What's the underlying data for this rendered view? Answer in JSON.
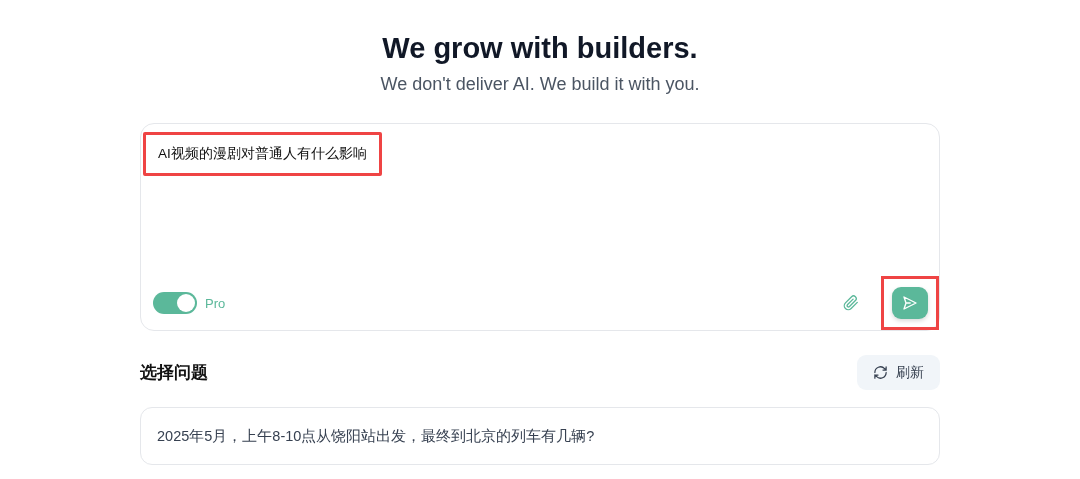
{
  "header": {
    "title": "We grow with builders.",
    "subtitle": "We don't deliver AI. We build it with you."
  },
  "composer": {
    "value": "AI视频的漫剧对普通人有什么影响",
    "value_highlighted": true,
    "pro_toggle": {
      "label": "Pro",
      "on": true
    },
    "send_highlighted": true
  },
  "questions": {
    "title": "选择问题",
    "refresh_label": "刷新",
    "items": [
      {
        "text": "2025年5月，上午8-10点从饶阳站出发，最终到北京的列车有几辆?"
      }
    ]
  }
}
